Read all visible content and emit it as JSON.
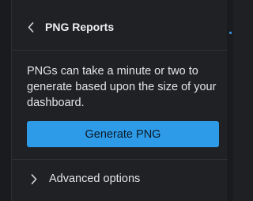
{
  "panel": {
    "title": "PNG Reports",
    "back_icon": "chevron-left-icon"
  },
  "description": "PNGs can take a minute or two to generate based upon the size of your dashboard.",
  "generate_button": {
    "label": "Generate PNG",
    "color": "#2d9be8"
  },
  "advanced": {
    "label": "Advanced options",
    "icon": "chevron-right-icon"
  },
  "colors": {
    "background": "#202124",
    "text": "#e3e4e6",
    "accent": "#2d9be8"
  }
}
